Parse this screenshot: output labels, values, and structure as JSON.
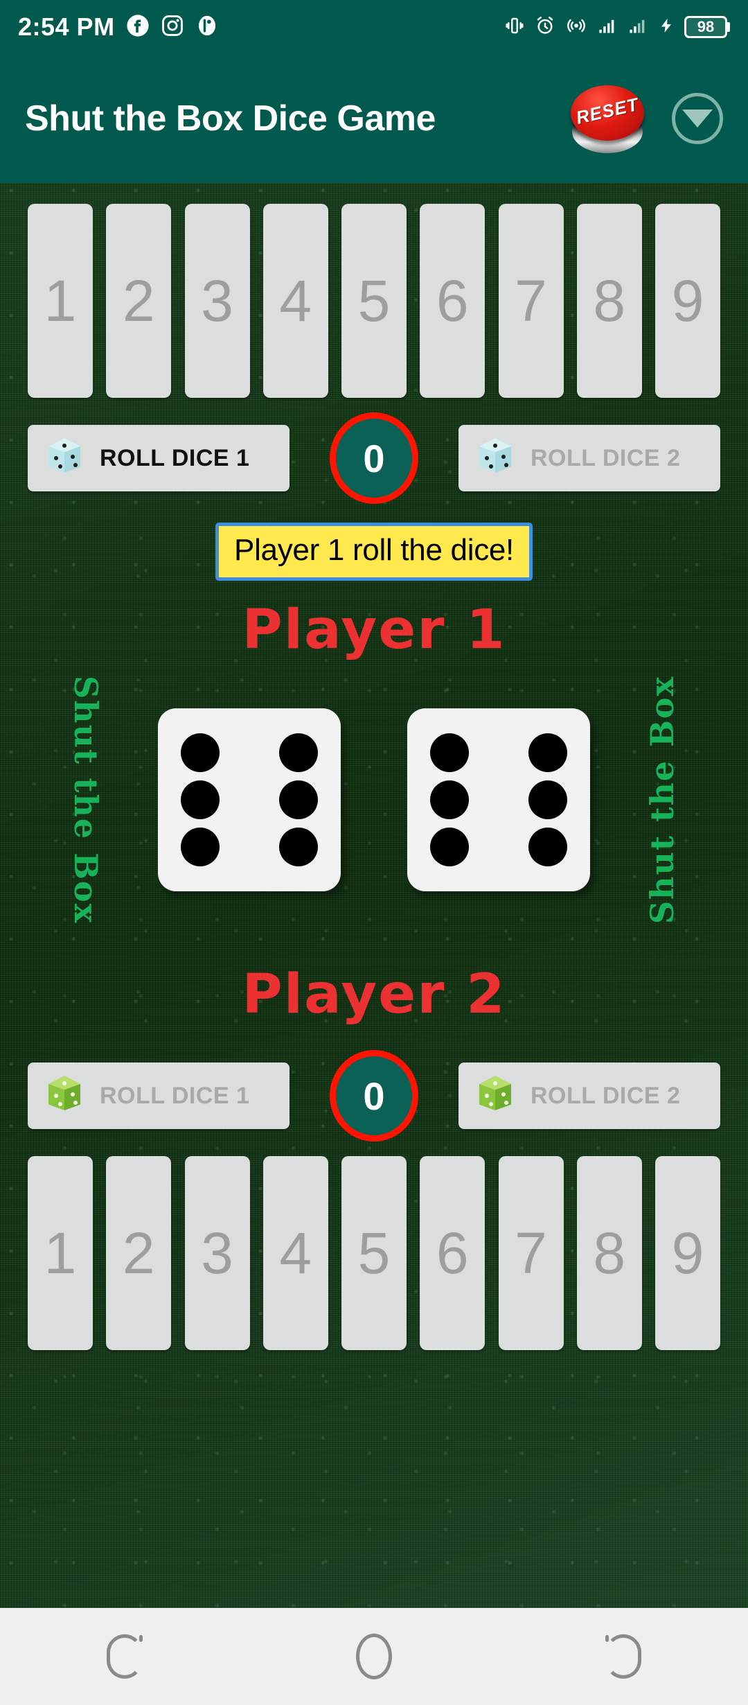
{
  "status_bar": {
    "time": "2:54 PM",
    "left_icons": [
      "facebook-icon",
      "instagram-icon",
      "app-icon"
    ],
    "right_icons": [
      "vibrate-icon",
      "alarm-icon",
      "hotspot-icon",
      "signal-1-icon",
      "signal-2-icon",
      "charging-icon"
    ],
    "battery_level": "98"
  },
  "app_bar": {
    "title": "Shut the Box Dice Game",
    "reset_label": "RESET",
    "dropdown_icon": "chevron-down-circle-icon"
  },
  "colors": {
    "appbar": "#015a4d",
    "board": "#143a1b",
    "tile": "#dcdedd",
    "tile_text": "#9e9e9e",
    "score_ring": "#ff1400",
    "score_fill": "#0c6157",
    "message_bg": "#ffe94e",
    "message_border": "#3d8ede",
    "player_name": "#eb3131",
    "side_label": "#18b25b"
  },
  "player1": {
    "name": "Player 1",
    "tiles": [
      "1",
      "2",
      "3",
      "4",
      "5",
      "6",
      "7",
      "8",
      "9"
    ],
    "roll_dice_1_label": "ROLL DICE 1",
    "roll_dice_2_label": "ROLL DICE 2",
    "roll_dice_1_enabled": true,
    "roll_dice_2_enabled": false,
    "score": "0",
    "dice_icon_color": "light-blue"
  },
  "player2": {
    "name": "Player 2",
    "tiles": [
      "1",
      "2",
      "3",
      "4",
      "5",
      "6",
      "7",
      "8",
      "9"
    ],
    "roll_dice_1_label": "ROLL DICE 1",
    "roll_dice_2_label": "ROLL DICE 2",
    "roll_dice_1_enabled": false,
    "roll_dice_2_enabled": false,
    "score": "0",
    "dice_icon_color": "green"
  },
  "message": "Player 1 roll the dice!",
  "side_labels": {
    "left": "Shut the Box",
    "right": "Shut the Box"
  },
  "dice": {
    "die1_value": 6,
    "die2_value": 6
  },
  "nav_bar": {
    "recents": "recents-icon",
    "home": "home-icon",
    "back": "back-icon"
  }
}
